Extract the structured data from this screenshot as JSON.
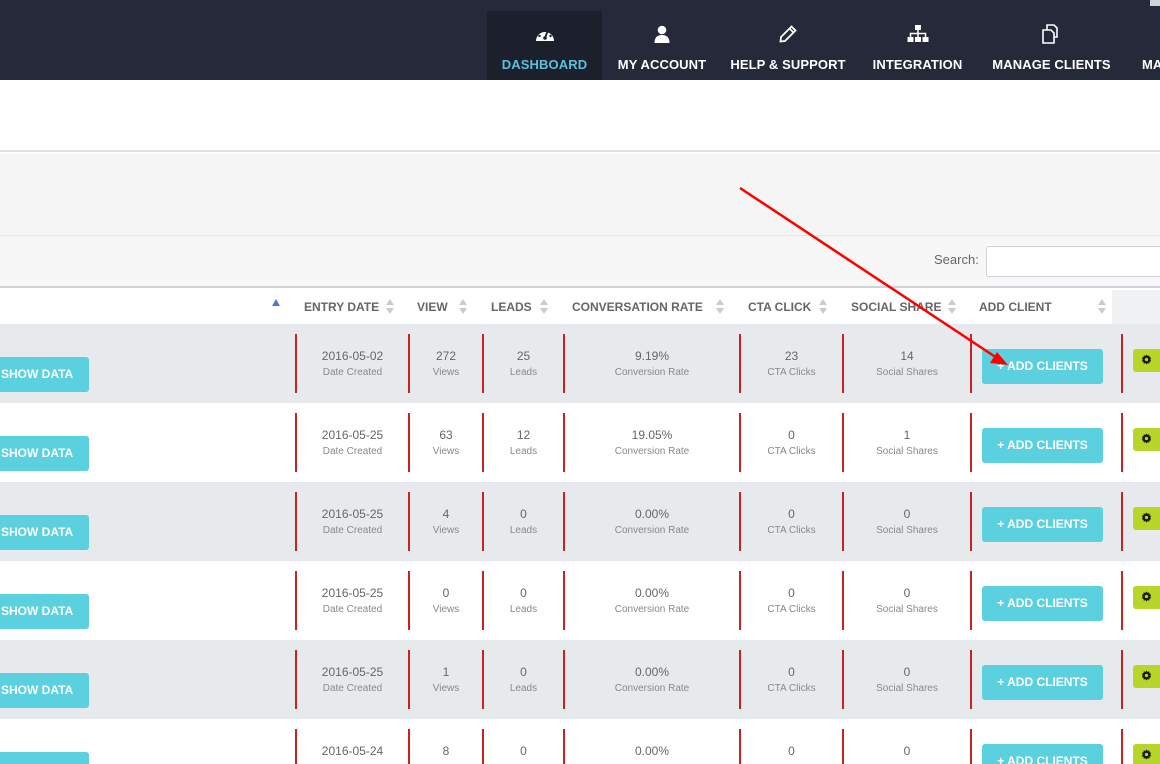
{
  "nav": {
    "items": [
      {
        "label": "DASHBOARD",
        "icon": "dashboard-gauge-icon",
        "active": true
      },
      {
        "label": "MY ACCOUNT",
        "icon": "user-icon",
        "active": false
      },
      {
        "label": "HELP & SUPPORT",
        "icon": "pencil-icon",
        "active": false
      },
      {
        "label": "INTEGRATION",
        "icon": "sitemap-icon",
        "active": false
      },
      {
        "label": "MANAGE CLIENTS",
        "icon": "copy-icon",
        "active": false
      },
      {
        "label": "MA",
        "icon": "",
        "active": false
      }
    ]
  },
  "search": {
    "label": "Search:",
    "value": ""
  },
  "table": {
    "columns": [
      "ENTRY DATE",
      "VIEW",
      "LEADS",
      "CONVERSATION RATE",
      "CTA CLICK",
      "SOCIAL SHARE",
      "ADD CLIENT"
    ],
    "sublabels": {
      "date": "Date Created",
      "views": "Views",
      "leads": "Leads",
      "rate": "Conversion Rate",
      "cta": "CTA Clicks",
      "social": "Social Shares"
    },
    "show_button": "SHOW DATA",
    "add_button": "+ ADD CLIENTS",
    "rows": [
      {
        "date": "2016-05-02",
        "views": "272",
        "leads": "25",
        "rate": "9.19%",
        "cta": "23",
        "social": "14"
      },
      {
        "date": "2016-05-25",
        "views": "63",
        "leads": "12",
        "rate": "19.05%",
        "cta": "0",
        "social": "1"
      },
      {
        "date": "2016-05-25",
        "views": "4",
        "leads": "0",
        "rate": "0.00%",
        "cta": "0",
        "social": "0"
      },
      {
        "date": "2016-05-25",
        "views": "0",
        "leads": "0",
        "rate": "0.00%",
        "cta": "0",
        "social": "0"
      },
      {
        "date": "2016-05-25",
        "views": "1",
        "leads": "0",
        "rate": "0.00%",
        "cta": "0",
        "social": "0"
      },
      {
        "date": "2016-05-24",
        "views": "8",
        "leads": "0",
        "rate": "0.00%",
        "cta": "0",
        "social": "0"
      }
    ]
  },
  "colors": {
    "nav_bg": "#26293a",
    "active_label": "#5bc0de",
    "button": "#5bd0de",
    "divider": "#c9231f",
    "gear_button": "#b8d52a",
    "annotation_arrow": "#ff0000"
  }
}
